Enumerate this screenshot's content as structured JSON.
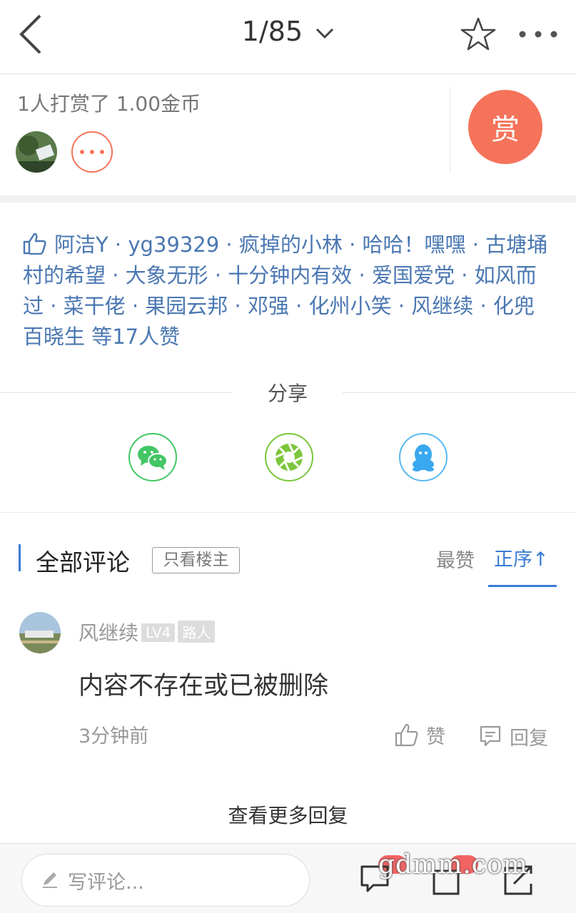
{
  "header": {
    "page_indicator": "1/85",
    "icons": [
      "back-arrow-icon",
      "chevron-down-icon",
      "star-icon",
      "more-icon"
    ]
  },
  "reward": {
    "summary": "1人打赏了 1.00金币",
    "button_label": "赏",
    "accent_color": "#f5735a"
  },
  "likes": {
    "text": "阿洁Y · yg39329 · 疯掉的小林 · 哈哈！嘿嘿 · 古塘埇村的希望 · 大象无形 · 十分钟内有效 · 爱国爱党 · 如风而过 · 菜干佬 · 果园云邦 · 邓强 · 化州小笑 · 风继续 · 化兜百晓生 等17人赞",
    "color": "#4a77b2"
  },
  "share": {
    "title": "分享",
    "targets": [
      "wechat-icon",
      "moments-icon",
      "qq-icon"
    ]
  },
  "comments": {
    "title": "全部评论",
    "op_only": "只看楼主",
    "sort_top": "最赞",
    "sort_asc": "正序↑",
    "accent_color": "#3a7bd5",
    "items": [
      {
        "user": "风继续",
        "level": "LV4",
        "rank": "路人",
        "body": "内容不存在或已被删除",
        "time": "3分钟前",
        "like_label": "赞",
        "reply_label": "回复"
      }
    ],
    "more_replies": "查看更多回复"
  },
  "bottom": {
    "input_placeholder": "写评论...",
    "watermark": "gdmm.com"
  }
}
